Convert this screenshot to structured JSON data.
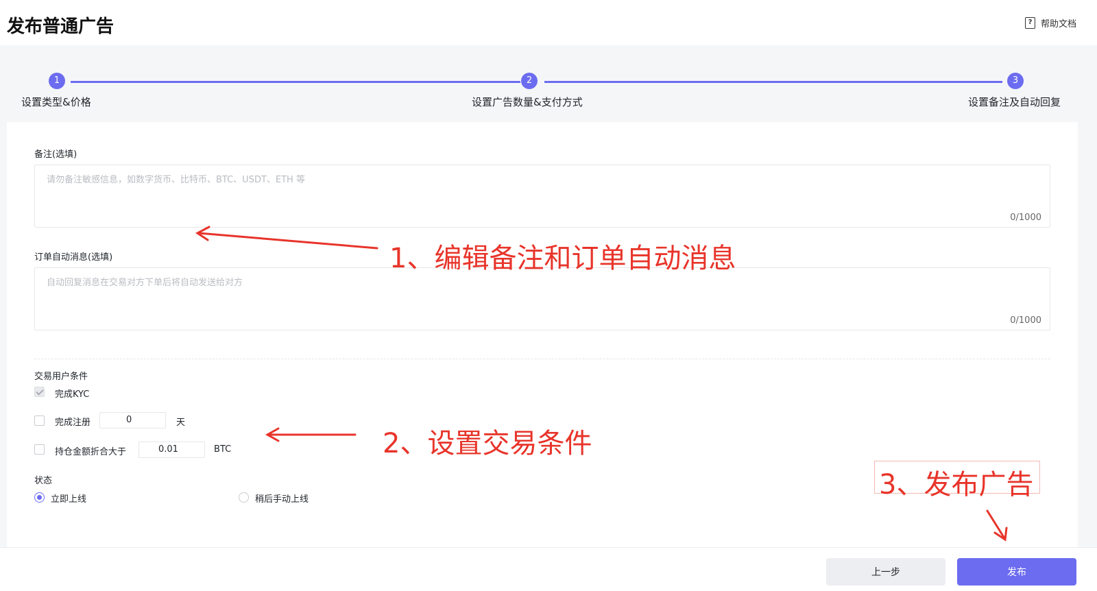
{
  "header": {
    "title": "发布普通广告",
    "help_label": "帮助文档",
    "help_icon_glyph": "?"
  },
  "stepper": {
    "accent": "#6c6cf0",
    "steps": [
      {
        "number": "1",
        "label": "设置类型&价格"
      },
      {
        "number": "2",
        "label": "设置广告数量&支付方式"
      },
      {
        "number": "3",
        "label": "设置备注及自动回复"
      }
    ]
  },
  "form": {
    "remark": {
      "label": "备注(选填)",
      "placeholder": "请勿备注敏感信息，如数字货币、比特币、BTC、USDT、ETH 等",
      "counter": "0/1000"
    },
    "auto_message": {
      "label": "订单自动消息(选填)",
      "placeholder": "自动回复消息在交易对方下单后将自动发送给对方",
      "counter": "0/1000"
    },
    "conditions": {
      "title": "交易用户条件",
      "kyc_label": "完成KYC",
      "kyc_checked": true,
      "register_label": "完成注册",
      "register_value": "0",
      "register_unit": "天",
      "register_checked": false,
      "holding_label": "持仓金额折合大于",
      "holding_value": "0.01",
      "holding_unit": "BTC",
      "holding_checked": false
    },
    "status": {
      "title": "状态",
      "options": [
        {
          "label": "立即上线",
          "selected": true
        },
        {
          "label": "稍后手动上线",
          "selected": false
        }
      ]
    }
  },
  "footer": {
    "prev_label": "上一步",
    "publish_label": "发布"
  },
  "annotations": {
    "color": "#e8342a",
    "notes": [
      "1、编辑备注和订单自动消息",
      "2、设置交易条件",
      "3、发布广告"
    ]
  }
}
